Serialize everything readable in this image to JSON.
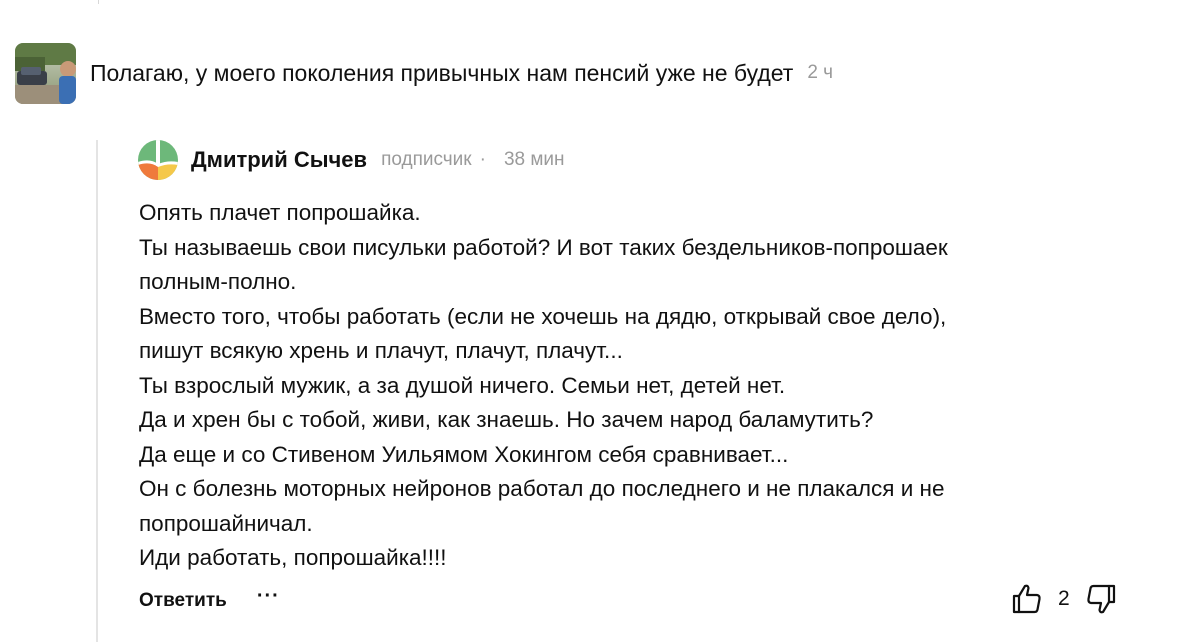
{
  "parent_comment": {
    "text": "Полагаю, у моего поколения привычных нам пенсий уже не будет",
    "time": "2 ч"
  },
  "reply": {
    "author": "Дмитрий Сычев",
    "role": "подписчик",
    "separator": "·",
    "time": "38 мин",
    "lines": [
      "Опять плачет попрошайка.",
      "Ты называешь свои писульки работой? И вот таких бездельников-попрошаек",
      "полным-полно.",
      "Вместо того, чтобы работать (если не хочешь на дядю, открывай свое дело),",
      "пишут всякую хрень и плачут, плачут, плачут...",
      "Ты взрослый мужик, а за душой ничего. Семьи нет, детей нет.",
      "Да и хрен бы с тобой, живи, как знаешь. Но зачем народ баламутить?",
      "Да еще и со Стивеном Уильямом Хокингом себя сравнивает...",
      "Он с болезнь моторных нейронов работал до последнего и не плакался и не",
      "попрошайничал.",
      "Иди работать, попрошайка!!!!"
    ],
    "actions": {
      "reply_label": "Ответить",
      "more_label": "···",
      "like_count": "2"
    }
  },
  "icons": {
    "like": "thumbs-up-icon",
    "dislike": "thumbs-down-icon",
    "more": "ellipsis-icon"
  },
  "colors": {
    "text": "#111111",
    "muted": "#9a9a9a",
    "thread_line": "#e4e4e4",
    "logo_green": "#6db87a",
    "logo_orange": "#ef7a3c",
    "logo_yellow": "#f5c84a"
  }
}
